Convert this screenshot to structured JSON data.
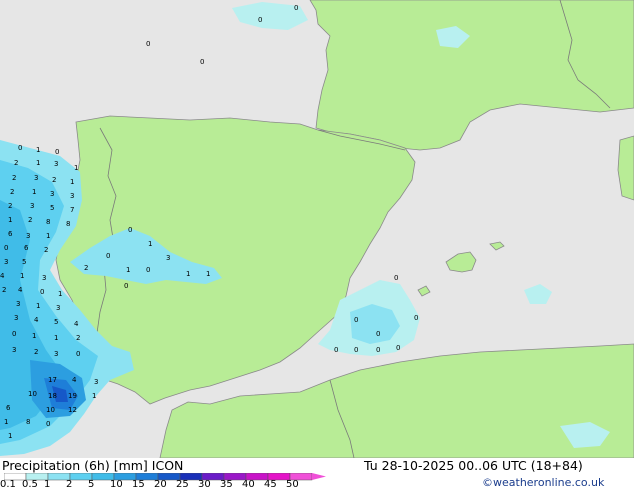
{
  "footer": {
    "product": "Precipitation (6h) [mm] ICON",
    "valid_time": "Tu 28-10-2025 00..06 UTC (18+84)",
    "credit": "©weatheronline.co.uk"
  },
  "legend": {
    "ticks": [
      "0.1",
      "0.5",
      "1",
      "2",
      "5",
      "10",
      "15",
      "20",
      "25",
      "30",
      "35",
      "40",
      "45",
      "50"
    ],
    "colors": [
      "#ffffff",
      "#b8f0f0",
      "#8ce2f2",
      "#5ed0f0",
      "#40bce8",
      "#2c9ee0",
      "#1e7ed8",
      "#1658c8",
      "#1a30b8",
      "#6a1cc8",
      "#9a18c8",
      "#c814c8",
      "#e414c8",
      "#f050d8"
    ]
  },
  "colors": {
    "land": "#b8ec96",
    "sea": "#e6e6e6",
    "border": "#7a7a7a",
    "coast": "#8a8a8a"
  },
  "precip_labels": [
    "0",
    "1",
    "0",
    "2",
    "1",
    "3",
    "1",
    "2",
    "3",
    "2",
    "1",
    "2",
    "1",
    "3",
    "3",
    "2",
    "3",
    "5",
    "7",
    "1",
    "2",
    "8",
    "8",
    "6",
    "3",
    "1",
    "0",
    "6",
    "2",
    "3",
    "5",
    "4",
    "1",
    "3",
    "2",
    "4",
    "0",
    "1",
    "3",
    "1",
    "3",
    "3",
    "4",
    "5",
    "4",
    "0",
    "1",
    "1",
    "2",
    "3",
    "2",
    "3",
    "0",
    "17",
    "4",
    "3",
    "10",
    "18",
    "19",
    "1",
    "10",
    "12",
    "6",
    "1",
    "8",
    "0",
    "1",
    "0",
    "1",
    "3",
    "1",
    "0",
    "2",
    "1",
    "0",
    "1",
    "0",
    "0",
    "0",
    "0",
    "0",
    "0",
    "0",
    "0",
    "0",
    "0",
    "0",
    "0",
    "0"
  ]
}
